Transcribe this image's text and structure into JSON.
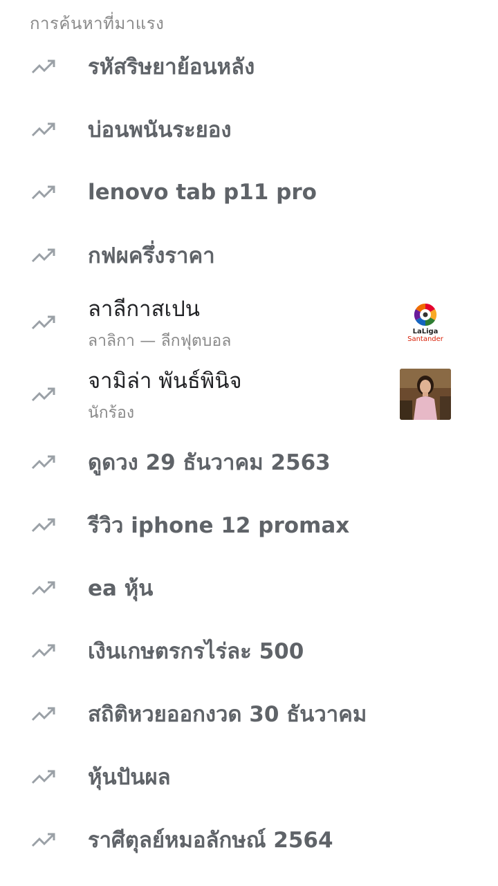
{
  "section_title": "การค้นหาที่มาแรง",
  "icons": {
    "trend": "trending-up-icon",
    "trend_color": "#9aa0a6"
  },
  "trends": [
    {
      "title": "รหัสริษยาย้อนหลัง"
    },
    {
      "title": "บ่อนพนันระยอง"
    },
    {
      "title": "lenovo tab p11 pro"
    },
    {
      "title": "กฟผครึ่งราคา"
    },
    {
      "title": "ลาลีกาสเปน",
      "subtitle": "ลาลิกา — ลีกฟุตบอล",
      "thumb": "laliga-logo",
      "logo_line1": "LaLiga",
      "logo_line2": "Santander"
    },
    {
      "title": "จามิล่า พันธ์พินิจ",
      "subtitle": "นักร้อง",
      "thumb": "person-photo"
    },
    {
      "title": "ดูดวง 29 ธันวาคม 2563"
    },
    {
      "title": "รีวิว iphone 12 promax"
    },
    {
      "title": "ea หุ้น"
    },
    {
      "title": "เงินเกษตรกรไร่ละ 500"
    },
    {
      "title": "สถิติหวยออกงวด 30 ธันวาคม"
    },
    {
      "title": "หุ้นปันผล"
    },
    {
      "title": "ราศีตุลย์หมอลักษณ์ 2564"
    }
  ]
}
